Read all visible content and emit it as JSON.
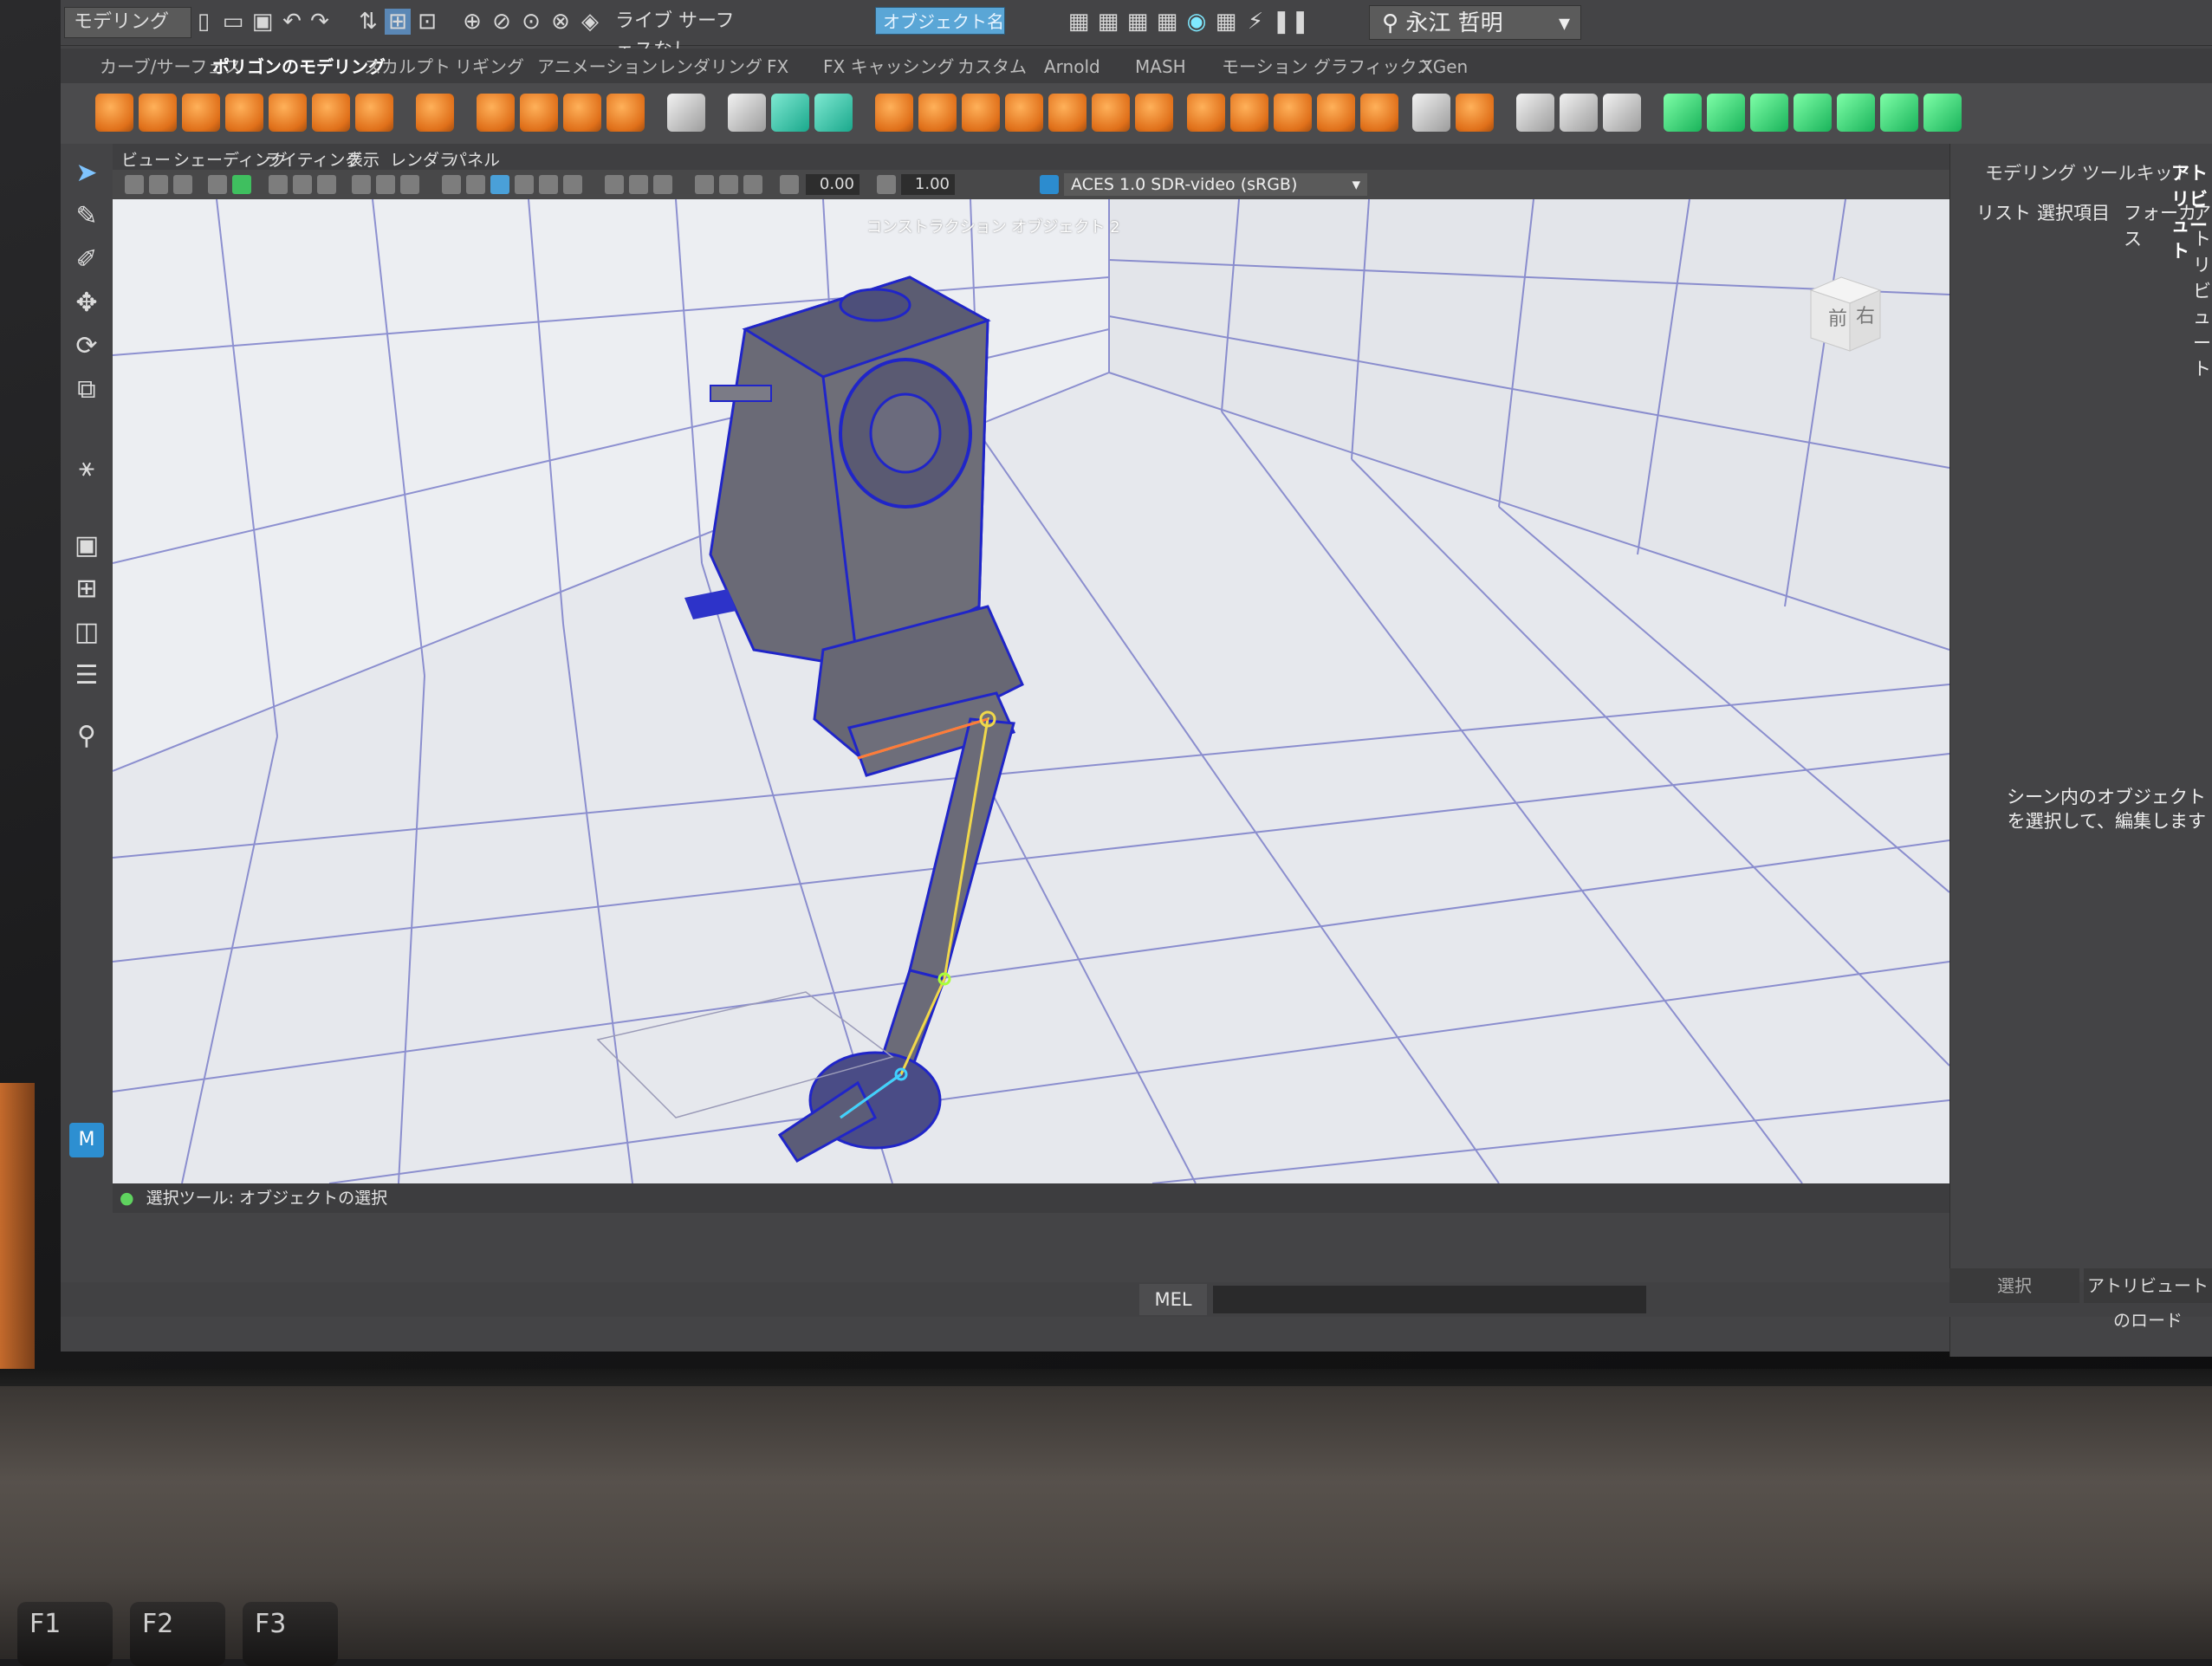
{
  "status_line": {
    "workspace_menu": "モデリング",
    "live_surface": "ライブ サーフェスなし",
    "object_field": "オブジェクト名",
    "user_name": "永江 哲明"
  },
  "shelf_tabs": [
    "カーブ/サーフェス",
    "ポリゴンのモデリング",
    "スカルプト",
    "リギング",
    "アニメーション",
    "レンダリング",
    "FX",
    "FX キャッシング",
    "カスタム",
    "Arnold",
    "MASH",
    "モーション グラフィックス",
    "XGen"
  ],
  "active_shelf_tab": "ポリゴンのモデリング",
  "viewport": {
    "menu": [
      "ビュー",
      "シェーディング",
      "ライティング",
      "表示",
      "レンダラ",
      "パネル"
    ],
    "exposure": "0.00",
    "gamma": "1.00",
    "color_space": "ACES 1.0 SDR-video (sRGB)",
    "title": "コンストラクション オブジェクト 2",
    "view_cube": {
      "front": "前",
      "right": "右"
    }
  },
  "right_panel": {
    "tabs": [
      "モデリング ツールキット",
      "アトリビュート"
    ],
    "sub_menu": [
      "リスト",
      "選択項目",
      "フォーカス",
      "アトリビュート"
    ],
    "hint": "シーン内のオブジェクトを選択して、編集します",
    "bottom_buttons": [
      "選択",
      "アトリビュートのロード"
    ]
  },
  "help_line": "選択ツール: オブジェクトの選択",
  "command_line": {
    "language": "MEL"
  },
  "keyboard": [
    "F1",
    "F2",
    "F3"
  ],
  "colors": {
    "ui_dark": "#444446",
    "viewport_bg": "#eceef2",
    "wireframe_select": "#1f2bd6",
    "shelf_orange": "#f08a24",
    "field_blue": "#5aa6d6"
  }
}
